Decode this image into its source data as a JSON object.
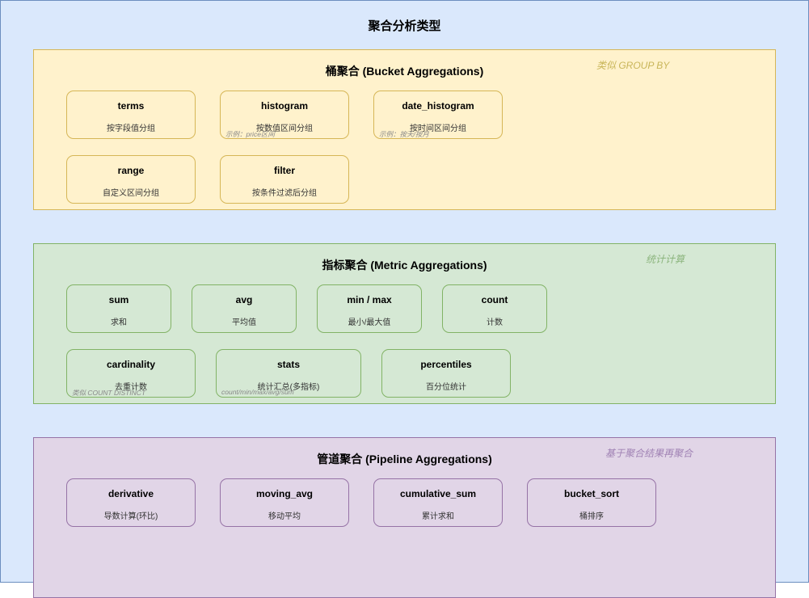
{
  "title": "聚合分析类型",
  "colors": {
    "background": "#dae8fc",
    "background_border": "#6c8ebf",
    "bucket_fill": "#fff2cc",
    "bucket_border": "#d6b656",
    "metric_fill": "#d5e8d4",
    "metric_border": "#82b366",
    "pipeline_fill": "#e1d5e7",
    "pipeline_border": "#9673a6"
  },
  "sections": [
    {
      "id": "bucket",
      "title": "桶聚合 (Bucket Aggregations)",
      "note": "类似 GROUP BY",
      "cards": [
        {
          "name": "terms",
          "desc": "按字段值分组",
          "note": ""
        },
        {
          "name": "histogram",
          "desc": "按数值区间分组",
          "note": "示例：price区间"
        },
        {
          "name": "date_histogram",
          "desc": "按时间区间分组",
          "note": "示例：按天/按月"
        },
        {
          "name": "range",
          "desc": "自定义区间分组",
          "note": ""
        },
        {
          "name": "filter",
          "desc": "按条件过滤后分组",
          "note": ""
        }
      ]
    },
    {
      "id": "metric",
      "title": "指标聚合 (Metric Aggregations)",
      "note": "统计计算",
      "cards": [
        {
          "name": "sum",
          "desc": "求和",
          "note": ""
        },
        {
          "name": "avg",
          "desc": "平均值",
          "note": ""
        },
        {
          "name": "min / max",
          "desc": "最小/最大值",
          "note": ""
        },
        {
          "name": "count",
          "desc": "计数",
          "note": ""
        },
        {
          "name": "cardinality",
          "desc": "去重计数",
          "note": "类似 COUNT DISTINCT"
        },
        {
          "name": "stats",
          "desc": "统计汇总(多指标)",
          "note": "count/min/max/avg/sum"
        },
        {
          "name": "percentiles",
          "desc": "百分位统计",
          "note": ""
        }
      ]
    },
    {
      "id": "pipeline",
      "title": "管道聚合 (Pipeline Aggregations)",
      "note": "基于聚合结果再聚合",
      "cards": [
        {
          "name": "derivative",
          "desc": "导数计算(环比)",
          "note": ""
        },
        {
          "name": "moving_avg",
          "desc": "移动平均",
          "note": ""
        },
        {
          "name": "cumulative_sum",
          "desc": "累计求和",
          "note": ""
        },
        {
          "name": "bucket_sort",
          "desc": "桶排序",
          "note": ""
        }
      ]
    }
  ]
}
